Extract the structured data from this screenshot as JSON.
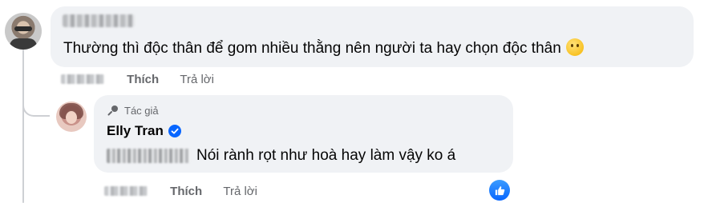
{
  "comment": {
    "author_name_blurred": true,
    "text": "Thường thì độc thân để gom nhiều thằng nên người ta hay chọn độc thân",
    "emoji": "thinking-face",
    "actions": {
      "like_label": "Thích",
      "reply_label": "Trả lời"
    }
  },
  "reply": {
    "badge_label": "Tác giả",
    "author_name": "Elly Tran",
    "verified": true,
    "mention_blurred": true,
    "text": "Nói rành rọt như hoà hay làm vậy ko á",
    "actions": {
      "like_label": "Thích",
      "reply_label": "Trả lời"
    },
    "reactions": [
      "like"
    ]
  },
  "colors": {
    "bubble_bg": "#f0f2f5",
    "action_text": "#65676b",
    "like_blue": "#0866ff",
    "verified_blue": "#0866ff"
  }
}
